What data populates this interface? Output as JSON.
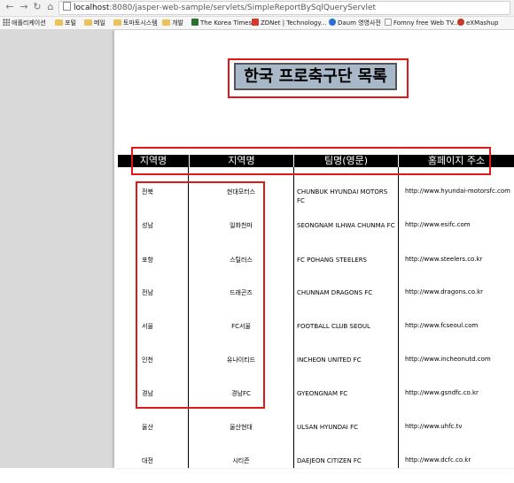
{
  "browser": {
    "url_host": "localhost",
    "url_path": ":8080/jasper-web-sample/servlets/SimpleReportBySqlQueryServlet",
    "bookmarks": [
      {
        "label": "애플리케이션",
        "icon": "apps-icon"
      },
      {
        "label": "포털",
        "icon": "folder-icon"
      },
      {
        "label": "메일",
        "icon": "folder-icon"
      },
      {
        "label": "토마토시스템",
        "icon": "folder-icon"
      },
      {
        "label": "개발",
        "icon": "folder-icon"
      },
      {
        "label": "The Korea Times",
        "icon": "site-icon"
      },
      {
        "label": "ZDNet | Technology...",
        "icon": "site-icon"
      },
      {
        "label": "Daum 영영사전",
        "icon": "site-icon"
      },
      {
        "label": "Fomny free Web TV...",
        "icon": "page-icon"
      },
      {
        "label": "eXMashup",
        "icon": "site-icon"
      }
    ]
  },
  "report": {
    "title": "한국 프로축구단 목록",
    "headers": [
      "지역명",
      "지역명",
      "팀명(영문)",
      "홈페이지 주소"
    ],
    "rows": [
      {
        "region": "전북",
        "team": "현대모터스",
        "english": "CHUNBUK HYUNDAI MOTORS FC",
        "url": "http://www.hyundai-motorsfc.com"
      },
      {
        "region": "성남",
        "team": "일화천마",
        "english": "SEONGNAM ILHWA CHUNMA FC",
        "url": "http://www.esifc.com"
      },
      {
        "region": "포항",
        "team": "스틸러스",
        "english": "FC POHANG STEELERS",
        "url": "http://www.steelers.co.kr"
      },
      {
        "region": "전남",
        "team": "드래곤즈",
        "english": "CHUNNAM DRAGONS FC",
        "url": "http://www.dragons.co.kr"
      },
      {
        "region": "서울",
        "team": "FC서울",
        "english": "FOOTBALL CLUB SEOUL",
        "url": "http://www.fcseoul.com"
      },
      {
        "region": "인천",
        "team": "유나이티드",
        "english": "INCHEON UNITED FC",
        "url": "http://www.incheonutd.com"
      },
      {
        "region": "경남",
        "team": "경남FC",
        "english": "GYEONGNAM FC",
        "url": "http://www.gsndfc.co.kr"
      },
      {
        "region": "울산",
        "team": "울산현대",
        "english": "ULSAN HYUNDAI FC",
        "url": "http://www.uhfc.tv"
      },
      {
        "region": "대전",
        "team": "시티즌",
        "english": "DAEJEON CITIZEN FC",
        "url": "http://www.dcfc.co.kr"
      }
    ]
  },
  "colors": {
    "annotation": "#e01818",
    "title_bg": "#a8b8c8",
    "header_bg": "#000000"
  }
}
